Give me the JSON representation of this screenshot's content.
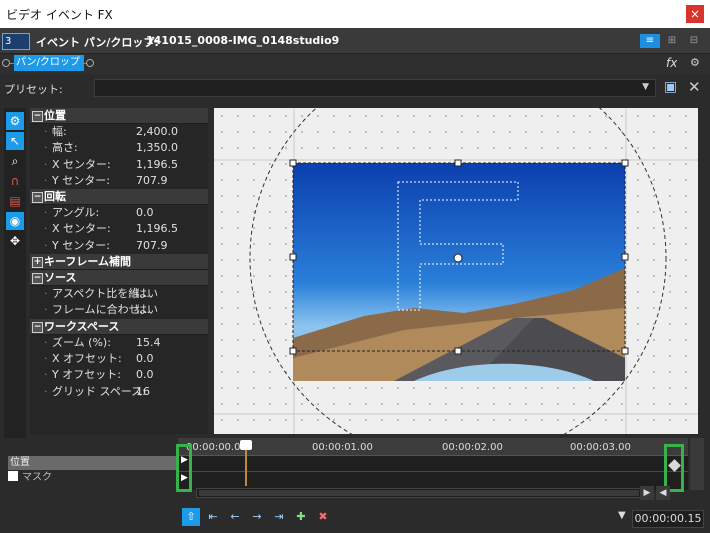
{
  "window": {
    "title": "ビデオ イベント FX",
    "close_glyph": "×"
  },
  "event": {
    "badge": "3",
    "label": "イベント パン/クロップ:",
    "name": "141015_0008-IMG_0148studio9"
  },
  "plugin_chain": {
    "plugin": "パン/クロップ"
  },
  "preset": {
    "label": "プリセット:",
    "value": ""
  },
  "sections": [
    {
      "title": "位置",
      "rows": [
        {
          "k": "幅:",
          "v": "2,400.0"
        },
        {
          "k": "高さ:",
          "v": "1,350.0"
        },
        {
          "k": "X センター:",
          "v": "1,196.5"
        },
        {
          "k": "Y センター:",
          "v": "707.9"
        }
      ]
    },
    {
      "title": "回転",
      "rows": [
        {
          "k": "アングル:",
          "v": "0.0"
        },
        {
          "k": "X センター:",
          "v": "1,196.5"
        },
        {
          "k": "Y センター:",
          "v": "707.9"
        }
      ]
    },
    {
      "title": "キーフレーム補間",
      "rows": []
    },
    {
      "title": "ソース",
      "rows": [
        {
          "k": "アスペクト比を維...",
          "v": "はい"
        },
        {
          "k": "フレームに合わせ...",
          "v": "はい"
        }
      ]
    },
    {
      "title": "ワークスペース",
      "rows": [
        {
          "k": "ズーム (%):",
          "v": "15.4"
        },
        {
          "k": "X オフセット:",
          "v": "0.0"
        },
        {
          "k": "Y オフセット:",
          "v": "0.0"
        },
        {
          "k": "グリッド スペース:",
          "v": "16"
        }
      ]
    }
  ],
  "timeline": {
    "ticks": [
      "00:00:00.00",
      "00:00:01.00",
      "00:00:02.00",
      "00:00:03.00"
    ],
    "tracks": [
      "位置",
      "マスク"
    ],
    "timecode": "00:00:00.15",
    "keyframe_color": "#38b24a",
    "playhead_color": "#c08a3a"
  },
  "colors": {
    "accent": "#1e9be8"
  }
}
